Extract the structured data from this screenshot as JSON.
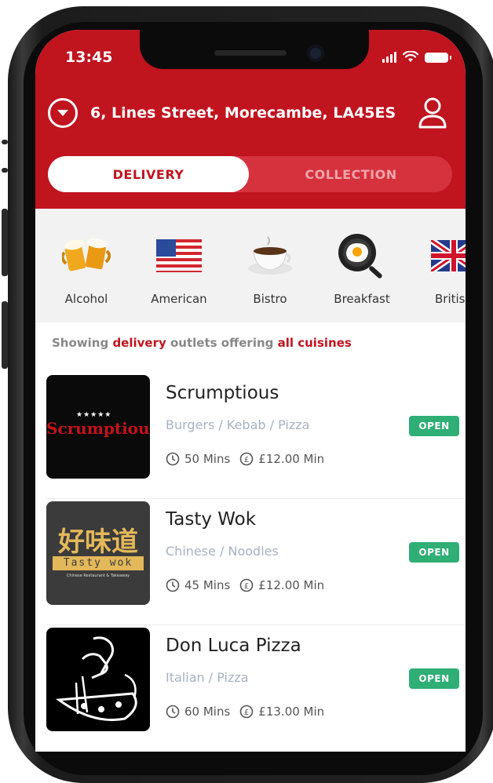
{
  "status_bar": {
    "time": "13:45"
  },
  "header": {
    "address": "6, Lines Street, Morecambe, LA45ES",
    "tabs": [
      {
        "label": "DELIVERY",
        "active": true
      },
      {
        "label": "COLLECTION",
        "active": false
      }
    ]
  },
  "cuisines": [
    {
      "label": "Alcohol",
      "icon": "beer-mugs-icon"
    },
    {
      "label": "American",
      "icon": "us-flag-icon"
    },
    {
      "label": "Bistro",
      "icon": "coffee-cup-icon"
    },
    {
      "label": "Breakfast",
      "icon": "frying-pan-egg-icon"
    },
    {
      "label": "British",
      "icon": "uk-flag-icon"
    }
  ],
  "filter_summary": {
    "prefix": "Showing",
    "mode": "delivery",
    "middle": "outlets offering",
    "cuisine": "all cuisines"
  },
  "restaurants": [
    {
      "name": "Scrumptious",
      "tags": "Burgers / Kebab / Pizza",
      "time": "50 Mins",
      "min_order": "£12.00 Min",
      "status": "OPEN",
      "logo_text": "Scrumptious"
    },
    {
      "name": "Tasty Wok",
      "tags": "Chinese / Noodles",
      "time": "45 Mins",
      "min_order": "£12.00 Min",
      "status": "OPEN",
      "logo_text": "好味道",
      "logo_sub": "Tasty wok",
      "logo_caption": "Chinese Restaurant & Takeaway"
    },
    {
      "name": "Don Luca Pizza",
      "tags": "Italian / Pizza",
      "time": "60 Mins",
      "min_order": "£13.00 Min",
      "status": "OPEN"
    }
  ],
  "colors": {
    "brand": "#c0141f",
    "open_badge": "#2fae75",
    "tag_text": "#a6b1c2"
  }
}
